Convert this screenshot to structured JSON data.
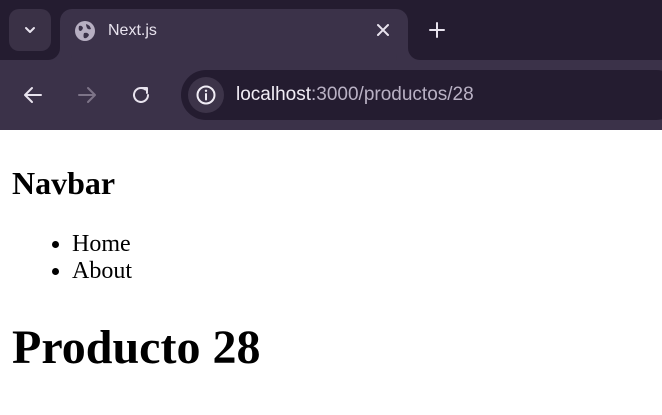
{
  "browser": {
    "tab": {
      "title": "Next.js",
      "favicon": "globe-icon"
    },
    "url": {
      "host": "localhost",
      "rest": ":3000/productos/28"
    },
    "colors": {
      "frame": "#241c30",
      "toolbar": "#3b3249",
      "omnibox": "#241c30"
    }
  },
  "page": {
    "navbar_title": "Navbar",
    "nav_links": [
      "Home",
      "About"
    ],
    "heading": "Producto 28"
  }
}
